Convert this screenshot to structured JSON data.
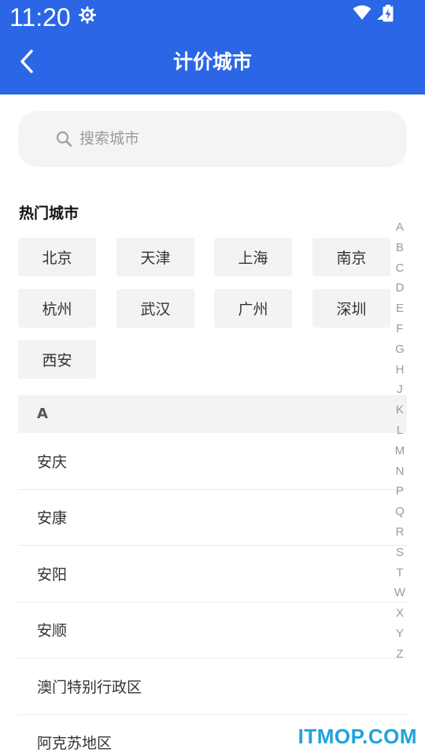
{
  "status_bar": {
    "time": "11:20",
    "icons": [
      "gear-icon",
      "wifi-icon",
      "signal-icon",
      "battery-charging-icon"
    ]
  },
  "header": {
    "title": "计价城市",
    "back_icon": "chevron-left-icon"
  },
  "search": {
    "placeholder": "搜索城市",
    "icon": "search-icon"
  },
  "hot_cities": {
    "title": "热门城市",
    "items": [
      "北京",
      "天津",
      "上海",
      "南京",
      "杭州",
      "武汉",
      "广州",
      "深圳",
      "西安"
    ]
  },
  "section": {
    "letter": "A",
    "cities": [
      "安庆",
      "安康",
      "安阳",
      "安顺",
      "澳门特别行政区",
      "阿克苏地区"
    ]
  },
  "index_bar": [
    "A",
    "B",
    "C",
    "D",
    "E",
    "F",
    "G",
    "H",
    "J",
    "K",
    "L",
    "M",
    "N",
    "P",
    "Q",
    "R",
    "S",
    "T",
    "W",
    "X",
    "Y",
    "Z"
  ],
  "watermark": "ITMOP.COM",
  "colors": {
    "primary": "#2a66e5",
    "chip_bg": "#f2f3f5",
    "search_bg": "#f4f4f4",
    "watermark": "#1fa3d9"
  }
}
